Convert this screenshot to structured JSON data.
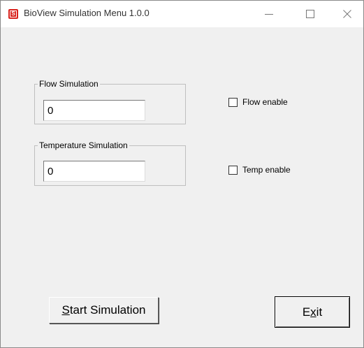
{
  "window": {
    "title": "BioView Simulation Menu 1.0.0",
    "app_icon_letter": "S"
  },
  "flow_group": {
    "label": "Flow Simulation",
    "value": "0"
  },
  "temp_group": {
    "label": "Temperature Simulation",
    "value": "0"
  },
  "flow_enable": {
    "label": "Flow enable",
    "checked": false
  },
  "temp_enable": {
    "label": "Temp enable",
    "checked": false
  },
  "start_button": {
    "mnemonic": "S",
    "label_rest": "tart Simulation"
  },
  "exit_button": {
    "label_before": "E",
    "mnemonic": "x",
    "label_after": "it"
  }
}
